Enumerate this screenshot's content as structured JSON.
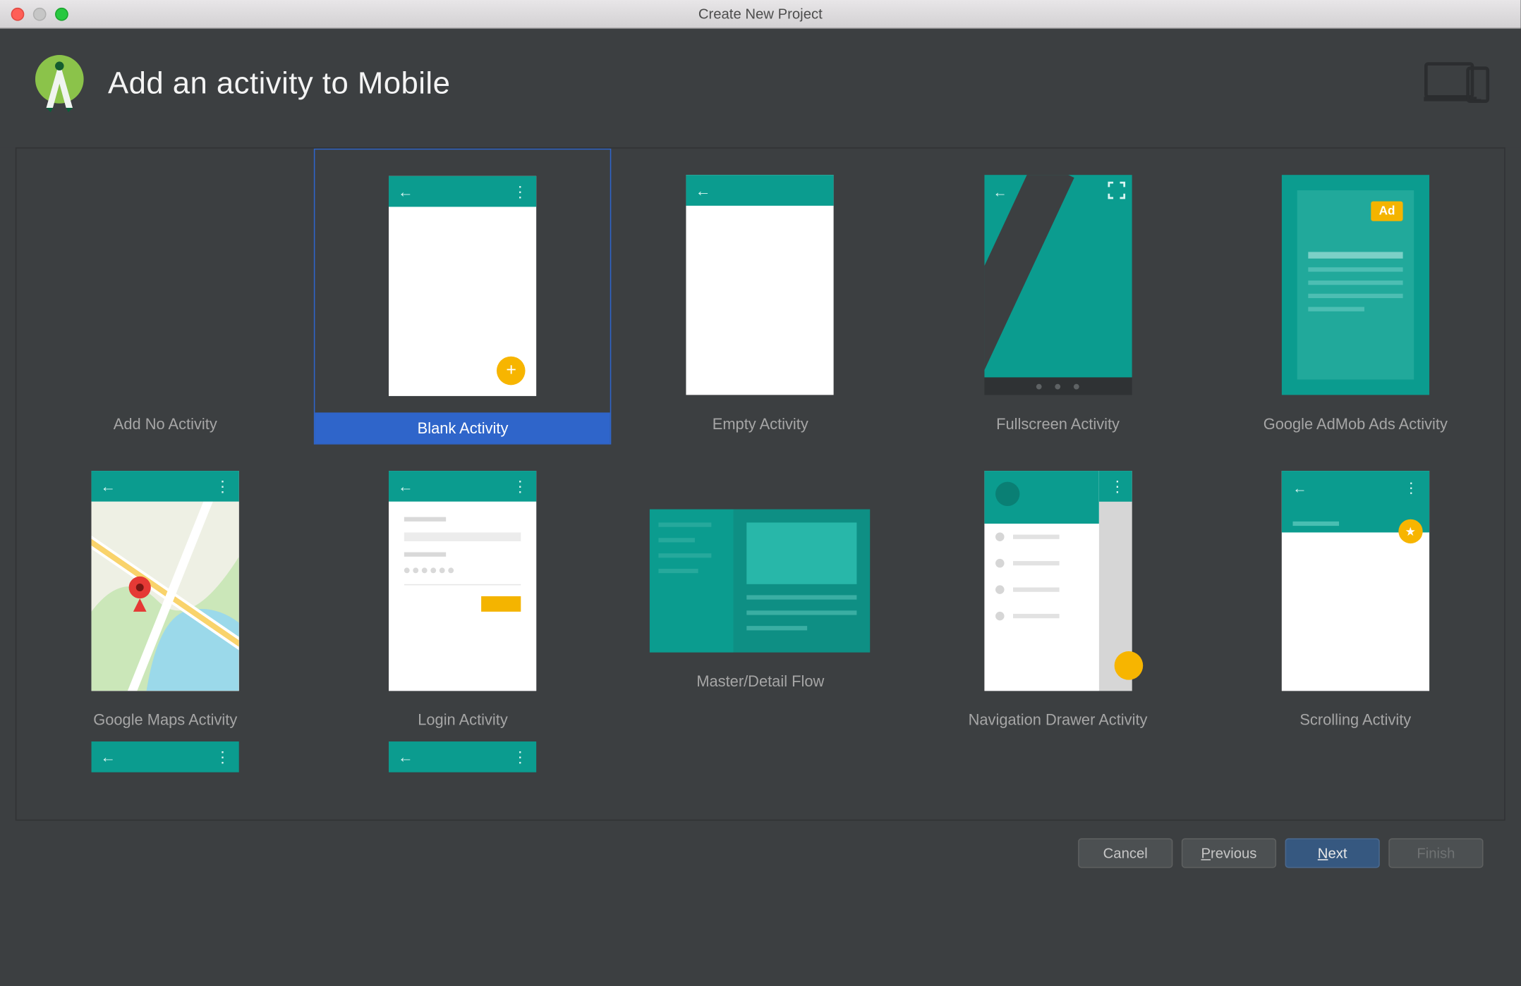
{
  "window": {
    "title": "Create New Project"
  },
  "header": {
    "title": "Add an activity to Mobile"
  },
  "tiles": [
    {
      "label": "Add No Activity"
    },
    {
      "label": "Blank Activity"
    },
    {
      "label": "Empty Activity"
    },
    {
      "label": "Fullscreen Activity"
    },
    {
      "label": "Google AdMob Ads Activity"
    },
    {
      "label": "Google Maps Activity"
    },
    {
      "label": "Login Activity"
    },
    {
      "label": "Master/Detail Flow"
    },
    {
      "label": "Navigation Drawer Activity"
    },
    {
      "label": "Scrolling Activity"
    }
  ],
  "ad_chip": "Ad",
  "footer": {
    "cancel": "Cancel",
    "previous_prefix": "P",
    "previous_rest": "revious",
    "next_prefix": "N",
    "next_rest": "ext",
    "finish": "Finish"
  }
}
